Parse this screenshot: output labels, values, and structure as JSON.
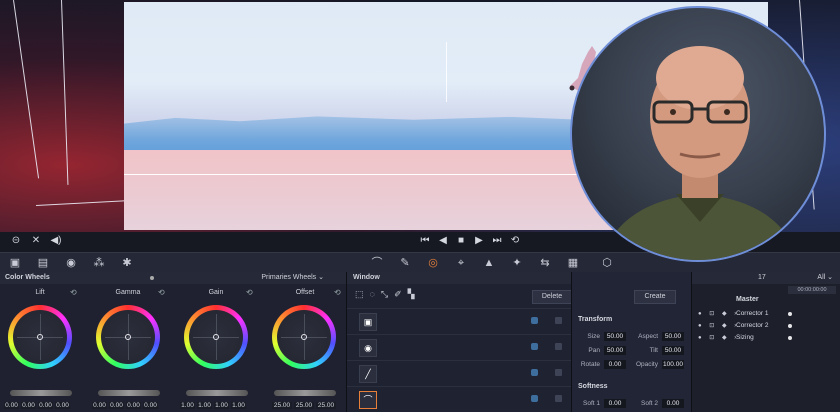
{
  "transport": {
    "left_icons": [
      "link-icon",
      "close-icon",
      "speaker-icon"
    ],
    "controls": [
      "skip-back-icon",
      "step-back-icon",
      "stop-icon",
      "play-icon",
      "skip-forward-icon",
      "loop-icon"
    ]
  },
  "palette": {
    "icons": [
      "camera-raw-icon",
      "color-match-icon",
      "color-wheels-icon",
      "rgb-mixer-icon",
      "motion-effects-icon",
      "curves-icon",
      "color-warper-icon",
      "qualifier-icon",
      "window-icon",
      "tracker-icon",
      "magic-mask-icon",
      "blur-icon",
      "key-icon",
      "sizing-icon",
      "3d-icon"
    ],
    "active": "window-icon"
  },
  "color_wheels": {
    "title": "Color Wheels",
    "mode": "Primaries Wheels",
    "wheels": [
      {
        "label": "Lift",
        "values": [
          "0.00",
          "0.00",
          "0.00",
          "0.00"
        ]
      },
      {
        "label": "Gamma",
        "values": [
          "0.00",
          "0.00",
          "0.00",
          "0.00"
        ]
      },
      {
        "label": "Gain",
        "values": [
          "1.00",
          "1.00",
          "1.00",
          "1.00"
        ]
      },
      {
        "label": "Offset",
        "values": [
          "25.00",
          "25.00",
          "25.00"
        ]
      }
    ]
  },
  "window": {
    "title": "Window",
    "delete_label": "Delete",
    "tools": [
      "square-icon",
      "circle-icon",
      "line-icon",
      "curve-icon",
      "gradient-icon"
    ],
    "shapes": [
      "square-icon",
      "circle-icon",
      "linear-icon",
      "curve-icon"
    ]
  },
  "transform": {
    "create_label": "Create",
    "title": "Transform",
    "fields": [
      {
        "label": "Size",
        "value": "50.00"
      },
      {
        "label": "Aspect",
        "value": "50.00"
      },
      {
        "label": "Pan",
        "value": "50.00"
      },
      {
        "label": "Tilt",
        "value": "50.00"
      },
      {
        "label": "Rotate",
        "value": "0.00"
      },
      {
        "label": "Opacity",
        "value": "100.00"
      }
    ],
    "softness_title": "Softness",
    "softness": [
      {
        "label": "Soft 1",
        "value": "0.00"
      },
      {
        "label": "Soft 2",
        "value": "0.00"
      }
    ]
  },
  "nodes": {
    "header_number": "17",
    "all_label": "All",
    "range": "00:00:00:00",
    "master": "Master",
    "rows": [
      "Corrector 1",
      "Corrector 2",
      "Sizing"
    ]
  }
}
